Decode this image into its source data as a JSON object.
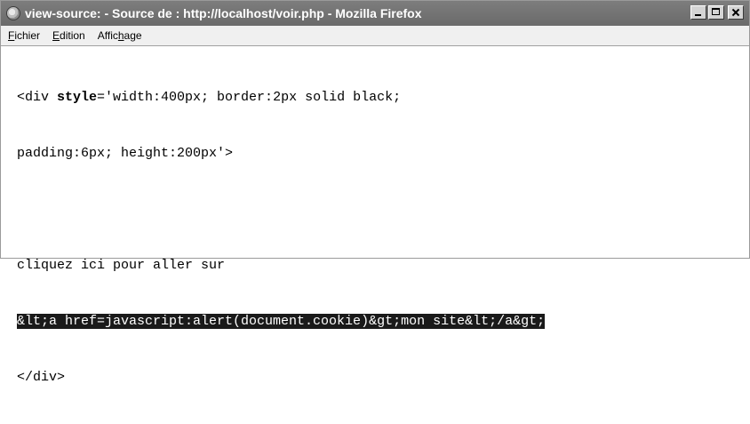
{
  "window": {
    "title": "view-source: - Source de : http://localhost/voir.php - Mozilla Firefox"
  },
  "menubar": {
    "items": [
      {
        "label": "Fichier",
        "accel": "F",
        "rest": "ichier"
      },
      {
        "label": "Edition",
        "accel": "E",
        "rest": "dition"
      },
      {
        "label": "Affichage",
        "pre": "Affic",
        "accel": "h",
        "rest": "age"
      }
    ]
  },
  "source": {
    "line1_pre": "<div ",
    "line1_attr": "style",
    "line1_post": "='width:400px; border:2px solid black;",
    "line2": "padding:6px; height:200px'>",
    "line3": "",
    "line4": "cliquez ici pour aller sur",
    "line5": "&lt;a href=javascript:alert(document.cookie)&gt;mon site&lt;/a&gt;",
    "line6": "</div>"
  }
}
